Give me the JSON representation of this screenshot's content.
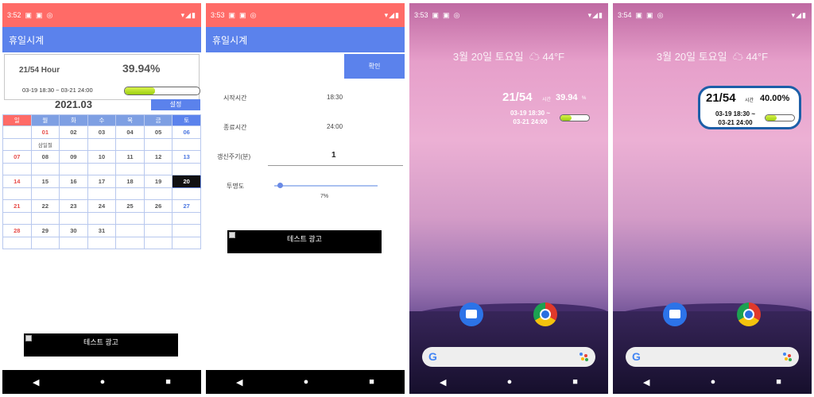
{
  "panel1": {
    "status_time": "3:52",
    "app_title": "휴일시계",
    "hours": "21/54 Hour",
    "percent": "39.94%",
    "range": "03-19 18:30 ~ 03-21 24:00",
    "progress_value": 0.4,
    "month": "2021.03",
    "set_label": "설정",
    "weekdays": [
      "일",
      "월",
      "화",
      "수",
      "목",
      "금",
      "토"
    ],
    "weeks": [
      [
        "",
        "01",
        "02",
        "03",
        "04",
        "05",
        "06"
      ],
      [
        "",
        "삼일절",
        "",
        "",
        "",
        "",
        ""
      ],
      [
        "07",
        "08",
        "09",
        "10",
        "11",
        "12",
        "13"
      ],
      [
        "",
        "",
        "",
        "",
        "",
        "",
        ""
      ],
      [
        "14",
        "15",
        "16",
        "17",
        "18",
        "19",
        "20"
      ],
      [
        "",
        "",
        "",
        "",
        "",
        "",
        ""
      ],
      [
        "21",
        "22",
        "23",
        "24",
        "25",
        "26",
        "27"
      ],
      [
        "",
        "",
        "",
        "",
        "",
        "",
        ""
      ],
      [
        "28",
        "29",
        "30",
        "31",
        "",
        "",
        ""
      ],
      [
        "",
        "",
        "",
        "",
        "",
        "",
        ""
      ]
    ],
    "ad_label": "테스트 광고"
  },
  "panel2": {
    "status_time": "3:53",
    "app_title": "휴일시계",
    "ok_label": "확인",
    "start_label": "시작시간",
    "start_value": "18:30",
    "end_label": "종료시간",
    "end_value": "24:00",
    "refresh_label": "갱신주기(분)",
    "refresh_value": "1",
    "opacity_label": "투명도",
    "opacity_value": "7%",
    "ad_label": "테스트 광고"
  },
  "panel3": {
    "status_time": "3:53",
    "date_weather": "3월 20일 토요일",
    "temperature": "44°F",
    "widget_hours": "21/54",
    "widget_unit": "시간",
    "widget_percent": "39.94",
    "widget_percent_sign": "%",
    "widget_range_1": "03-19 18:30 ~",
    "widget_range_2": "03-21 24:00",
    "progress_value": 0.4
  },
  "panel4": {
    "status_time": "3:54",
    "date_weather": "3월 20일 토요일",
    "temperature": "44°F",
    "widget_hours": "21/54",
    "widget_unit": "시간",
    "widget_percent": "40.00%",
    "widget_range_1": "03-19 18:30 ~",
    "widget_range_2": "03-21 24:00",
    "progress_value": 0.4
  },
  "colors": {
    "statusbar": "#ff6b67",
    "appbar": "#5b82ec",
    "widget_border": "#1d5fa8"
  },
  "icons": [
    "message-icon",
    "gmail-icon",
    "sync-icon",
    "wifi-icon",
    "signal-icon",
    "battery-icon",
    "back-icon",
    "home-icon",
    "recents-icon",
    "cloud-icon",
    "messages-app-icon",
    "chrome-icon",
    "google-icon",
    "mic-icon"
  ]
}
